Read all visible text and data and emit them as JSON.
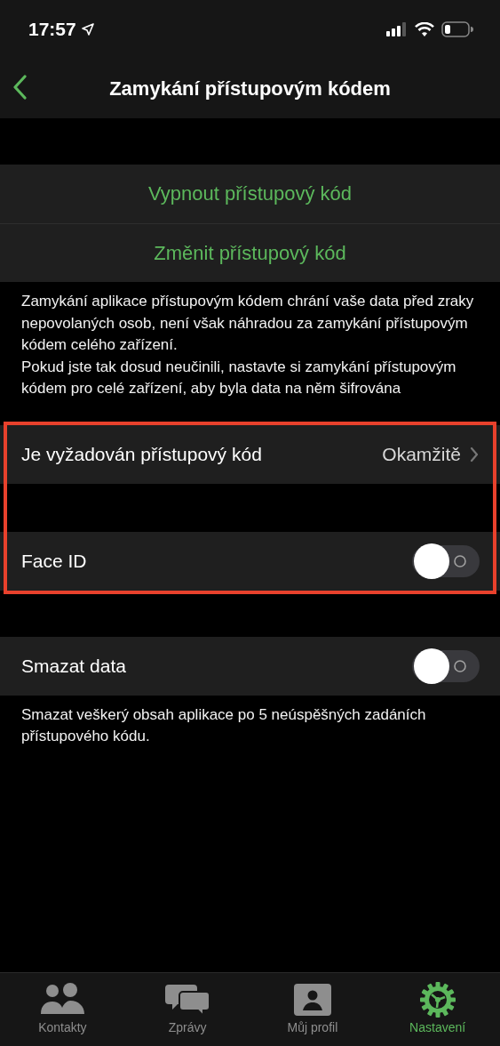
{
  "status_bar": {
    "time": "17:57"
  },
  "nav": {
    "title": "Zamykání přístupovým kódem"
  },
  "blocks": [
    {
      "highlighted": false,
      "groups": [
        {
          "rows": [
            {
              "kind": "action",
              "label": "Vypnout přístupový kód"
            },
            {
              "kind": "action",
              "label": "Změnit přístupový kód"
            }
          ],
          "footer": "Zamykání aplikace přístupovým kódem chrání vaše data před zraky nepovolaných osob, není však náhradou za zamykání přístupovým kódem celého zařízení.\nPokud jste tak dosud neučinili, nastavte si zamykání přístupovým kódem pro celé zařízení, aby byla data na něm šifrována"
        }
      ]
    },
    {
      "highlighted": true,
      "groups": [
        {
          "rows": [
            {
              "kind": "disclosure",
              "label": "Je vyžadován přístupový kód",
              "value": "Okamžitě"
            }
          ]
        },
        {
          "rows": [
            {
              "kind": "toggle",
              "label": "Face ID",
              "on": false
            }
          ]
        }
      ]
    },
    {
      "highlighted": false,
      "groups": [
        {
          "rows": [
            {
              "kind": "toggle",
              "label": "Smazat data",
              "on": false
            }
          ],
          "footer": "Smazat veškerý obsah aplikace po 5 neúspěšných zadáních přístupového kódu."
        }
      ]
    }
  ],
  "tab_bar": [
    {
      "label": "Kontakty",
      "kind": "people",
      "selected": false
    },
    {
      "label": "Zprávy",
      "kind": "chat",
      "selected": false
    },
    {
      "label": "Můj profil",
      "kind": "profile",
      "selected": false
    },
    {
      "label": "Nastavení",
      "kind": "gear",
      "selected": true
    }
  ]
}
